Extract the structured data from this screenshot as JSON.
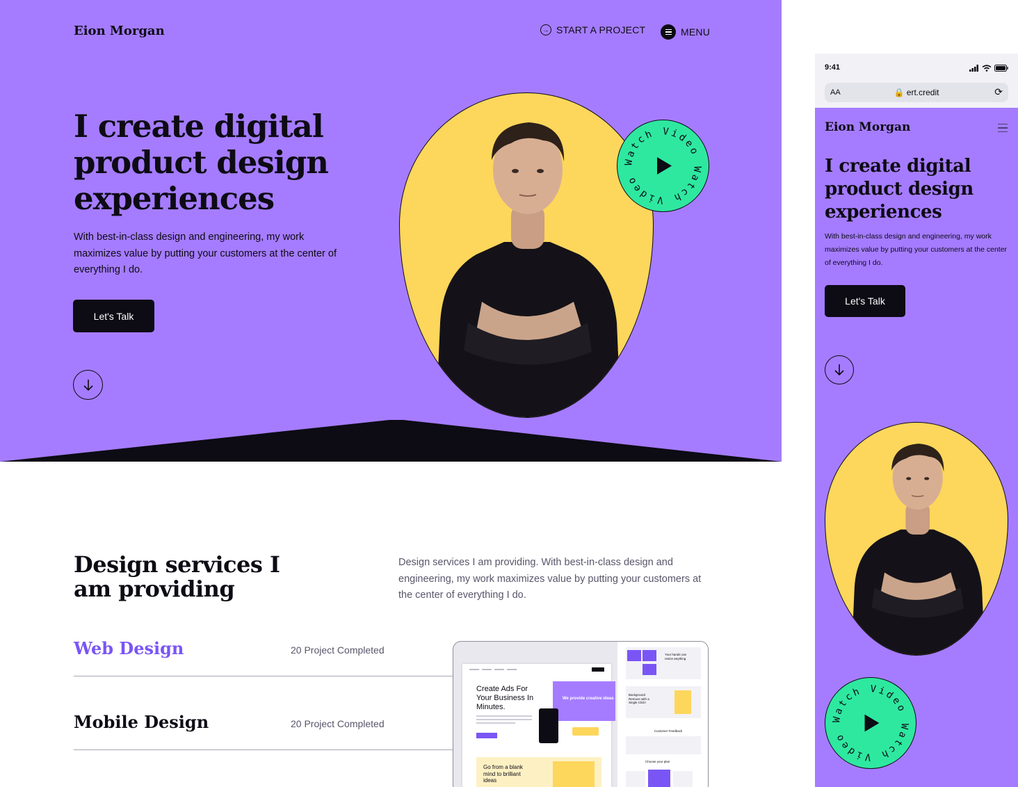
{
  "brand": {
    "name": "Eion Morgan"
  },
  "colors": {
    "hero_bg": "#a57cff",
    "accent_yellow": "#fdd65c",
    "accent_green": "#2ee8a0",
    "ink": "#0d0b14",
    "link_purple": "#7a55f5"
  },
  "nav": {
    "start_project": "START A PROJECT",
    "menu": "MENU"
  },
  "hero": {
    "headline": "I create digital product design experiences",
    "subtitle": "With best-in-class design and engineering, my work maximizes value by putting your customers at the center of everything I do.",
    "cta": "Let's Talk",
    "watch_video": "Watch Video",
    "scroll_icon": "arrow-down-icon"
  },
  "services": {
    "title": "Design services I am providing",
    "description": "Design services I am providing. With best-in-class design and engineering, my work maximizes value by putting your customers at the center of everything I do.",
    "items": [
      {
        "name": "Web Design",
        "count": "20 Project Completed"
      },
      {
        "name": "Mobile Design",
        "count": "20 Project Completed"
      }
    ]
  },
  "preview": {
    "headline": "Create Ads For Your Business In Minutes.",
    "purple_text": "We provide creative ideas",
    "card_text": "Go from a blank mind to brilliant ideas",
    "right_heading_1": "Your hands can resize anything",
    "right_heading_2": "Background Remove with a Single Click!",
    "right_heading_3": "Customer Feedback",
    "right_heading_4": "Choose your plan"
  },
  "mobile": {
    "time": "9:41",
    "font_size_control": "AA",
    "url": "ert.credit",
    "reload_icon": "reload-icon"
  }
}
